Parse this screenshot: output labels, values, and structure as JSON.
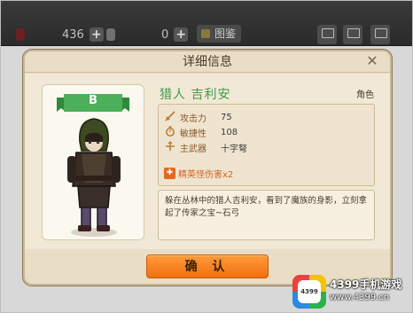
{
  "topbar": {
    "resource1_value": "436",
    "resource2_value": "0",
    "atlas_label": "图鉴",
    "plus_symbol": "+"
  },
  "dialog": {
    "title": "详细信息",
    "close_symbol": "✕",
    "rank": "B",
    "hero_name": "猎人 吉利安",
    "hero_type": "角色",
    "stats": [
      {
        "label": "攻击力",
        "value": "75",
        "icon": "sword-icon"
      },
      {
        "label": "敏捷性",
        "value": "108",
        "icon": "stopwatch-icon"
      },
      {
        "label": "主武器",
        "value": "十字弩",
        "icon": "crossbow-icon"
      }
    ],
    "elite_bonus": "精英怪伤害x2",
    "description": "躲在丛林中的猎人吉利安，看到了魔族的身影，立刻拿起了传家之宝~石弓",
    "confirm_label": "确 认"
  },
  "watermark": {
    "logo_text": "4399",
    "title": "4399手机游戏",
    "url": "www.4399.cn"
  },
  "colors": {
    "accent_green": "#3f9a4a",
    "confirm_orange": "#f07010",
    "panel_bg": "#e9ddc6"
  }
}
